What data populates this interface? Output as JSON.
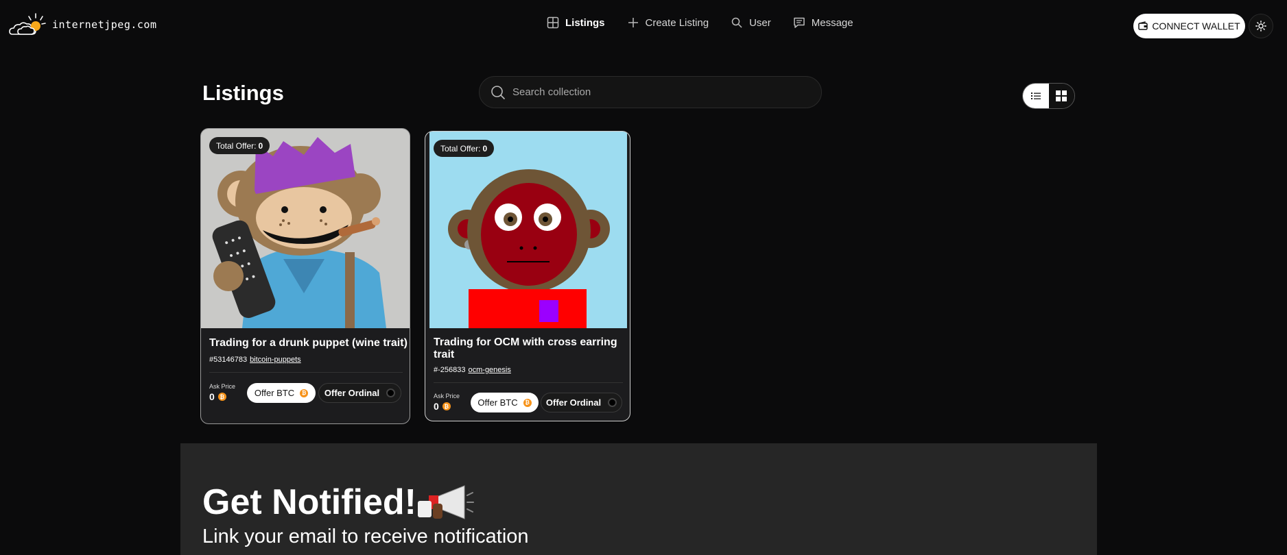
{
  "header": {
    "logo_text": "internetjpeg.com",
    "nav": [
      {
        "label": "Listings",
        "icon": "grid-icon",
        "active": true
      },
      {
        "label": "Create Listing",
        "icon": "plus-icon",
        "active": false
      },
      {
        "label": "User",
        "icon": "search-icon",
        "active": false
      },
      {
        "label": "Message",
        "icon": "message-icon",
        "active": false
      }
    ],
    "connect_wallet": "CONNECT WALLET"
  },
  "main": {
    "title": "Listings",
    "search_placeholder": "Search collection"
  },
  "cards": [
    {
      "badge_label": "Total Offer:",
      "badge_value": "0",
      "title": "Trading for a drunk puppet (wine trait)",
      "id": "#53146783",
      "collection": "bitcoin-puppets",
      "ask_label": "Ask Price",
      "ask_value": "0",
      "offer_btc": "Offer BTC",
      "offer_ordinal": "Offer Ordinal"
    },
    {
      "badge_label": "Total Offer:",
      "badge_value": "0",
      "title": "Trading for OCM with cross earring trait",
      "id": "#-256833",
      "collection": "ocm-genesis",
      "ask_label": "Ask Price",
      "ask_value": "0",
      "offer_btc": "Offer BTC",
      "offer_ordinal": "Offer Ordinal"
    }
  ],
  "notify": {
    "title": "Get Notified!",
    "subtitle": "Link your email to receive notification"
  },
  "colors": {
    "background": "#0b0b0c",
    "card": "#1c1c1e",
    "bitcoin": "#f7931a",
    "notify_bg": "#262626"
  }
}
